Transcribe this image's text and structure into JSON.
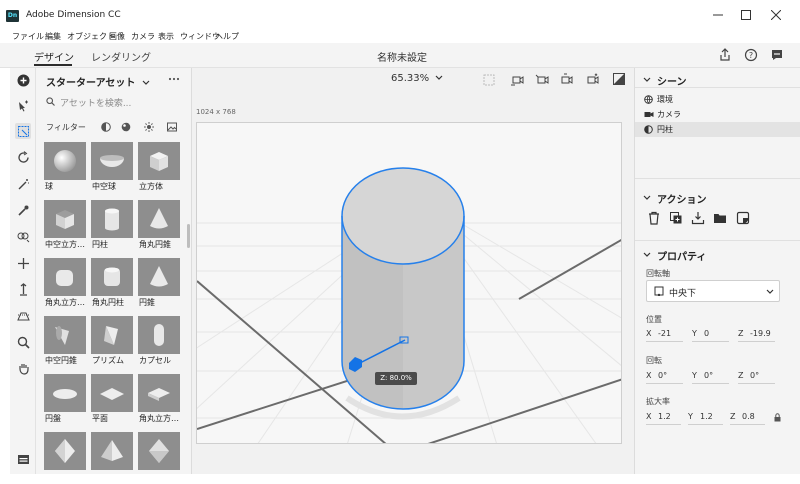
{
  "window": {
    "title": "Adobe Dimension CC",
    "logo": "Dn",
    "minimize_icon": "minimize-icon",
    "maximize_icon": "maximize-icon",
    "close_icon": "close-icon"
  },
  "menu": [
    "ファイル",
    "編集",
    "オブジェクト",
    "画像",
    "カメラ",
    "表示",
    "ウィンドウ",
    "ヘルプ"
  ],
  "tabs": {
    "design": "デザイン",
    "render": "レンダリング"
  },
  "document_title": "名称未設定",
  "header_icons": [
    "share-icon",
    "help-icon",
    "comment-icon"
  ],
  "toolbar_icons": [
    "add-icon",
    "select-icon",
    "frame-select-icon",
    "orbit-icon",
    "magic-wand-icon",
    "eyedropper-icon",
    "sample-icon",
    "move-icon",
    "vertical-move-icon",
    "horizon-icon",
    "zoom-icon",
    "hand-icon",
    "layers-panel-icon"
  ],
  "assets": {
    "title": "スターターアセット",
    "search_placeholder": "アセットを検索...",
    "filter_label": "フィルター",
    "items": [
      {
        "label": "球",
        "shape": "sphere"
      },
      {
        "label": "中空球",
        "shape": "hollow-sphere"
      },
      {
        "label": "立方体",
        "shape": "cube"
      },
      {
        "label": "中空立方…",
        "shape": "hollow-cube"
      },
      {
        "label": "円柱",
        "shape": "cylinder"
      },
      {
        "label": "角丸円錐",
        "shape": "rounded-cone"
      },
      {
        "label": "角丸立方…",
        "shape": "rounded-cube"
      },
      {
        "label": "角丸円柱",
        "shape": "rounded-cylinder"
      },
      {
        "label": "円錐",
        "shape": "cone"
      },
      {
        "label": "中空円錐",
        "shape": "hollow-cone"
      },
      {
        "label": "プリズム",
        "shape": "prism"
      },
      {
        "label": "カプセル",
        "shape": "capsule"
      },
      {
        "label": "円盤",
        "shape": "disc"
      },
      {
        "label": "平面",
        "shape": "plane"
      },
      {
        "label": "角丸立方…",
        "shape": "rounded-box"
      },
      {
        "label": "",
        "shape": "diamond"
      },
      {
        "label": "",
        "shape": "pyramid"
      },
      {
        "label": "",
        "shape": "octahedron"
      }
    ]
  },
  "viewport": {
    "zoom": "65.33%",
    "resolution": "1024 x 768",
    "tooltip": "Z: 80.0%"
  },
  "scene": {
    "title": "シーン",
    "items": [
      {
        "label": "環境",
        "icon": "environment-icon"
      },
      {
        "label": "カメラ",
        "icon": "camera-icon"
      },
      {
        "label": "円柱",
        "icon": "model-icon",
        "selected": true
      }
    ]
  },
  "actions": {
    "title": "アクション",
    "icons": [
      "delete-icon",
      "duplicate-icon",
      "drop-icon",
      "group-icon",
      "material-icon"
    ]
  },
  "properties": {
    "title": "プロパティ",
    "pivot_label": "回転軸",
    "pivot_value": "中央下",
    "position_label": "位置",
    "position": {
      "x": "-21",
      "y": "0",
      "z": "-19.9"
    },
    "rotation_label": "回転",
    "rotation": {
      "x": "0°",
      "y": "0°",
      "z": "0°"
    },
    "scale_label": "拡大率",
    "scale": {
      "x": "1.2",
      "y": "1.2",
      "z": "0.8"
    }
  },
  "colors": {
    "accent": "#2680eb",
    "panel": "#f4f4f4",
    "thumb": "#8e8e8e",
    "gizmo": "#1473e6"
  }
}
